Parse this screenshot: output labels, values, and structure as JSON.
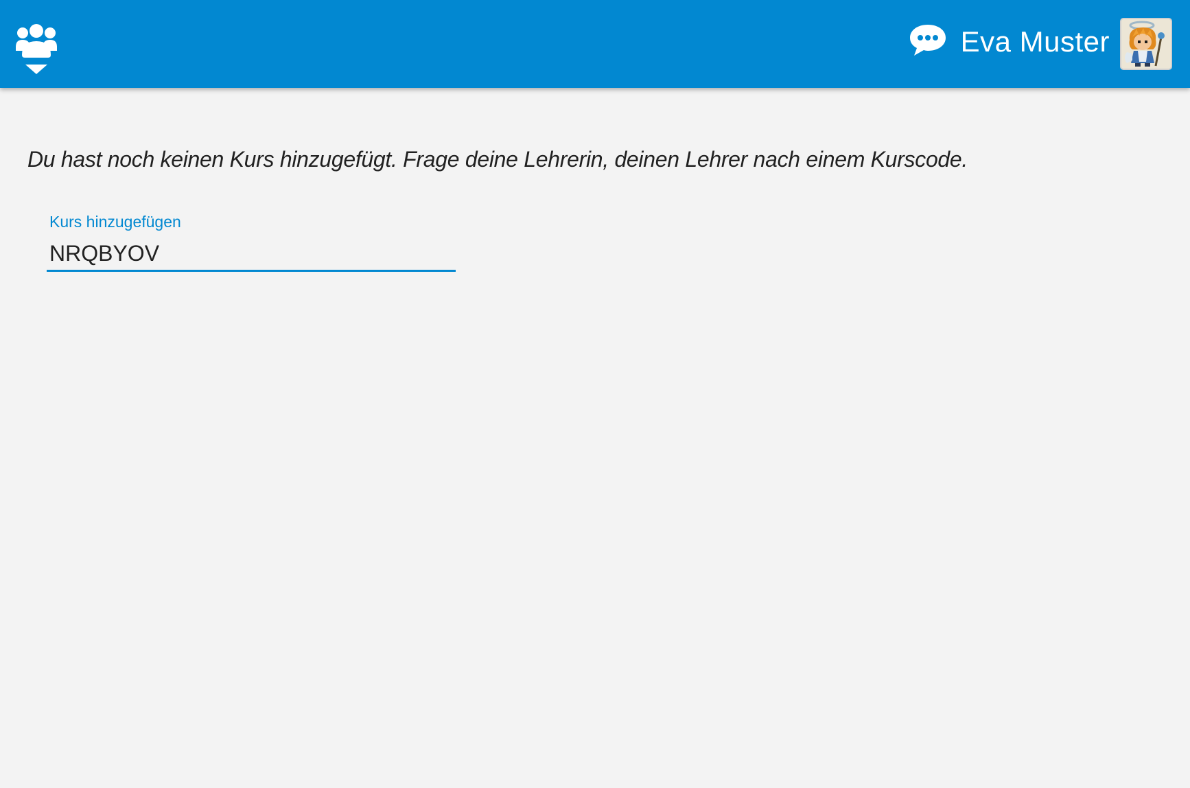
{
  "header": {
    "background_color": "#0288d1",
    "courses_menu_icon": "group-icon",
    "courses_menu_indicator": "caret-down-icon",
    "chat_icon": "chat-bubble-icon",
    "user_name": "Eva Muster",
    "avatar": "avatar-angel-character"
  },
  "main": {
    "empty_message": "Du hast noch keinen Kurs hinzugefügt. Frage deine Lehrerin, deinen Lehrer nach einem Kurscode.",
    "add_course": {
      "label": "Kurs hinzugefügen",
      "value": "NRQBYOV",
      "accent_color": "#0288d1"
    }
  }
}
